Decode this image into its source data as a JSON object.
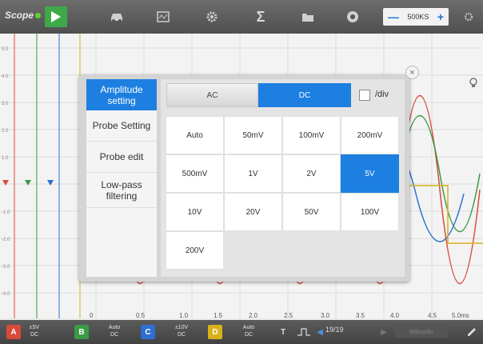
{
  "app": {
    "title": "Scope"
  },
  "toolbar": {
    "icons": [
      "play-icon",
      "car-icon",
      "scope-screen-icon",
      "gear-icon",
      "sigma-icon",
      "folder-icon",
      "camera-icon",
      "settings-icon"
    ],
    "sample_rate": "500KS",
    "minus": "—",
    "plus": "+"
  },
  "plot": {
    "x_ticks": [
      "0",
      "0.5",
      "1.0",
      "1.5",
      "2.0",
      "2.5",
      "3.0",
      "3.5",
      "4.0",
      "4.5",
      "5.0ms"
    ],
    "channel_colors": {
      "A": "#d94a3a",
      "B": "#3a9a46",
      "C": "#2f6fd0",
      "D": "#d8b21a"
    }
  },
  "dialog": {
    "close": "×",
    "menu": [
      "Amplitude setting",
      "Probe Setting",
      "Probe edit",
      "Low-pass filtering"
    ],
    "active_menu": "Amplitude setting",
    "coupling": {
      "ac": "AC",
      "dc": "DC",
      "selected": "DC"
    },
    "per_div_label": "/div",
    "per_div_checked": false,
    "ranges": [
      "Auto",
      "50mV",
      "100mV",
      "200mV",
      "500mV",
      "1V",
      "2V",
      "5V",
      "10V",
      "20V",
      "50V",
      "100V",
      "200V"
    ],
    "selected_range": "5V"
  },
  "bottom": {
    "channels": [
      {
        "id": "A",
        "range": "±5V",
        "coupling": "DC",
        "color": "#d94a3a"
      },
      {
        "id": "B",
        "range": "Auto",
        "coupling": "DC",
        "color": "#3a9a46"
      },
      {
        "id": "C",
        "range": "±10V",
        "coupling": "DC",
        "color": "#2f6fd0"
      },
      {
        "id": "D",
        "range": "Auto",
        "coupling": "DC",
        "color": "#d8b21a"
      }
    ],
    "trigger": "T",
    "page": "19/19",
    "time_div": "500us/div"
  }
}
